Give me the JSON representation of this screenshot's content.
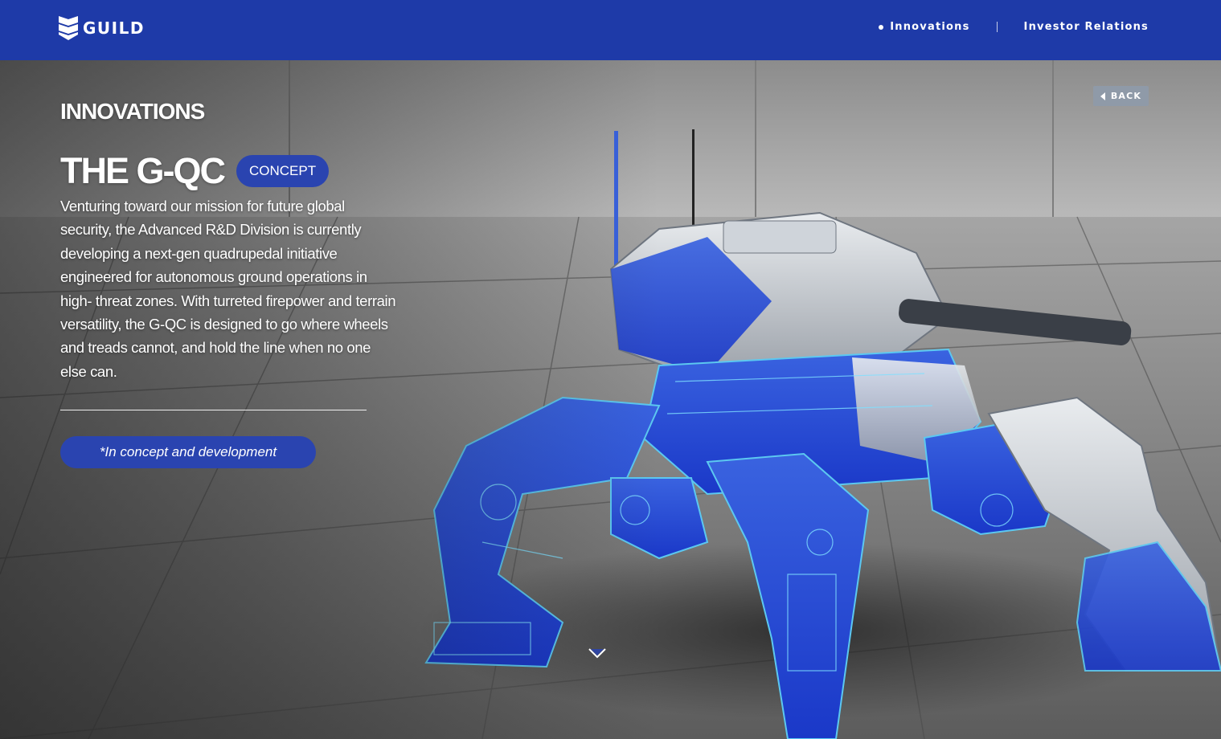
{
  "header": {
    "brand": "GUILD",
    "nav": [
      {
        "label": "Innovations",
        "active": true
      },
      {
        "label": "Investor Relations",
        "active": false
      }
    ],
    "background_color": "#1e3aa8"
  },
  "page": {
    "section_label": "INNOVATIONS",
    "title": "THE G-QC",
    "badge": "CONCEPT",
    "description": "Venturing toward our mission for future global security, the Advanced R&D Division is currently developing a next-gen quadrupedal initiative engineered for autonomous ground operations in high- threat zones. With turreted firepower and terrain versatility, the G-QC is designed to go where wheels and treads cannot, and hold the line when no one else can.",
    "development_note": "*In concept and development",
    "back_label": "BACK"
  },
  "hero_image": {
    "subject": "quadrupedal robot with turret (blueprint overlay)",
    "accent_color": "#2a44b0",
    "scroll_indicator": "chevron-down-icon"
  }
}
